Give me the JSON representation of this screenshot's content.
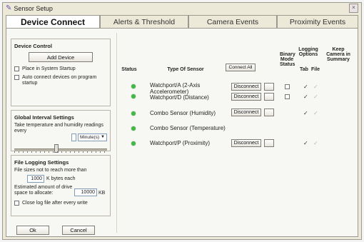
{
  "window": {
    "title": "Sensor Setup",
    "close_glyph": "×",
    "app_icon": "pencil-icon"
  },
  "tabs": [
    {
      "label": "Device Connect",
      "active": true
    },
    {
      "label": "Alerts & Threshold",
      "active": false
    },
    {
      "label": "Camera Events",
      "active": false
    },
    {
      "label": "Proximity Events",
      "active": false
    }
  ],
  "device_control": {
    "title": "Device Control",
    "add_device": "Add Device",
    "place_in_startup": "Place in System Startup",
    "auto_connect": "Auto connect devices on program startup"
  },
  "interval": {
    "title": "Global Interval Settings",
    "text": "Take temperature and humidity readings every",
    "unit": "Minute(s)",
    "value": ""
  },
  "logging": {
    "title": "File Logging Settings",
    "size_text": "File sizes not to reach more than",
    "size_value": "1000",
    "size_unit": "K bytes each",
    "space_text": "Estimated amount of drive space to allocate:",
    "space_value": "10000",
    "space_unit": "KB",
    "close_log": "Close log file after every write"
  },
  "footer": {
    "ok": "Ok",
    "cancel": "Cancel"
  },
  "table": {
    "connect_all": "Connect All",
    "headers": {
      "status": "Status",
      "type": "Type Of Sensor",
      "binary": "Binary Mode Status",
      "logging": "Logging Options",
      "tab": "Tab",
      "file": "File",
      "keep": "Keep Camera in Summary"
    },
    "disconnect_label": "Disconnect",
    "rows": [
      {
        "name": "Watchport/A (2-Axis Accelerometer)",
        "status_color": "#45b845"
      },
      {
        "name": "Watchport/D (Distance)",
        "status_color": "#45b845"
      },
      {
        "name": "Combo Sensor (Humidity)",
        "status_color": "#45b845"
      },
      {
        "name": "Combo Sensor (Temperature)",
        "status_color": "#45b845"
      },
      {
        "name": "Watchport/P (Proximity)",
        "status_color": "#45b845"
      }
    ]
  }
}
